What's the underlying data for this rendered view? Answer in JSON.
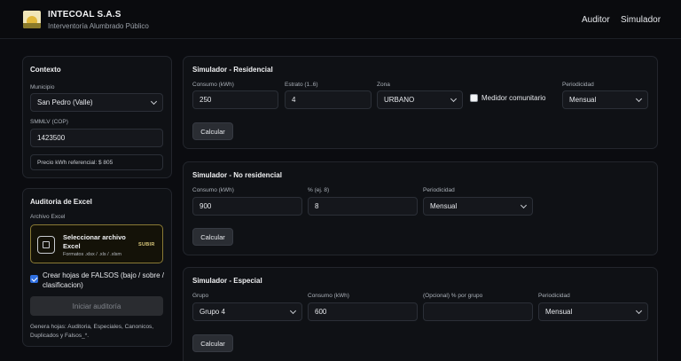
{
  "header": {
    "title": "INTECOAL S.A.S",
    "subtitle": "Interventoría Alumbrado Público",
    "nav": [
      "Auditor",
      "Simulador"
    ]
  },
  "contexto": {
    "title": "Contexto",
    "municipio_label": "Municipio",
    "municipio_value": "San Pedro (Valle)",
    "smmlv_label": "SMMLV (COP)",
    "smmlv_value": "1423500",
    "precio_note": "Precio kWh referencial: $ 805"
  },
  "auditoria": {
    "title": "Auditoria de Excel",
    "archivo_label": "Archivo Excel",
    "upload_title": "Seleccionar archivo Excel",
    "upload_formats": "Formatos .xlsx / .xls / .xlsm",
    "upload_action": "SUBIR",
    "falsos_label": "Crear hojas de FALSOS (bajo / sobre / clasificacion)",
    "falsos_checked": true,
    "start_button": "Iniciar auditoría",
    "help": "Genera hojas: Auditoria, Especiales, Canonicos, Duplicados y Falsos_*."
  },
  "residencial": {
    "title": "Simulador - Residencial",
    "consumo_label": "Consumo (kWh)",
    "consumo_value": "250",
    "estrato_label": "Estrato (1..6)",
    "estrato_value": "4",
    "zona_label": "Zona",
    "zona_value": "URBANO",
    "medidor_label": "Medidor comunitario",
    "medidor_checked": false,
    "periodicidad_label": "Periodicidad",
    "periodicidad_value": "Mensual",
    "calcular": "Calcular"
  },
  "no_residencial": {
    "title": "Simulador - No residencial",
    "consumo_label": "Consumo (kWh)",
    "consumo_value": "900",
    "pct_label": "% (ej. 8)",
    "pct_value": "8",
    "periodicidad_label": "Periodicidad",
    "periodicidad_value": "Mensual",
    "calcular": "Calcular"
  },
  "especial": {
    "title": "Simulador - Especial",
    "grupo_label": "Grupo",
    "grupo_value": "Grupo 4",
    "consumo_label": "Consumo (kWh)",
    "consumo_value": "600",
    "opcional_label": "(Opcional) % por grupo",
    "opcional_value": "",
    "periodicidad_label": "Periodicidad",
    "periodicidad_value": "Mensual",
    "calcular": "Calcular"
  },
  "colors": {
    "background": "#0b0c10",
    "panel": "#0f1115",
    "accent_gold": "#d8c77a",
    "checkbox_blue": "#2f6fe0"
  }
}
